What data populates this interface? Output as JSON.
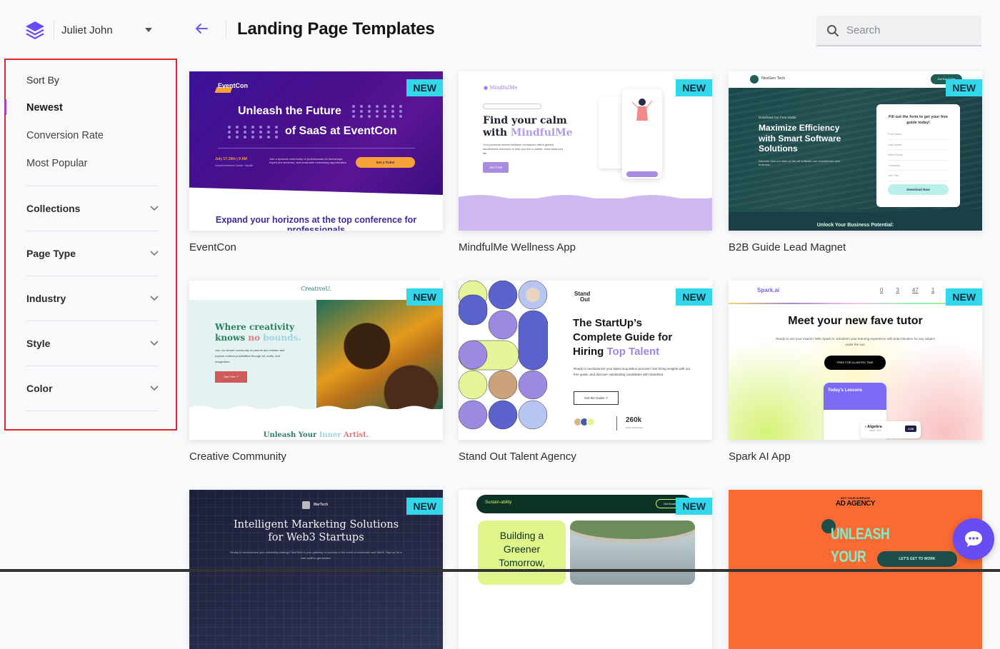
{
  "account": {
    "user_name": "Juliet John",
    "logo_icon": "layers-logo-icon",
    "dropdown_icon": "caret-down-icon"
  },
  "header": {
    "back_icon": "arrow-left-icon",
    "title": "Landing Page Templates"
  },
  "search": {
    "placeholder": "Search",
    "value": "",
    "icon": "search-icon"
  },
  "sidebar": {
    "sort_title": "Sort By",
    "sort_options": [
      {
        "label": "Newest",
        "active": true
      },
      {
        "label": "Conversion Rate",
        "active": false
      },
      {
        "label": "Most Popular",
        "active": false
      }
    ],
    "filters": [
      {
        "label": "Collections"
      },
      {
        "label": "Page Type"
      },
      {
        "label": "Industry"
      },
      {
        "label": "Style"
      },
      {
        "label": "Color"
      }
    ]
  },
  "colors": {
    "accent": "#6a4cf5",
    "badge": "#33d7ea",
    "highlight_border": "#e0242a",
    "active_indicator": "#a040c8"
  },
  "templates": [
    {
      "name": "EventCon",
      "badge": "NEW",
      "preview": {
        "brand": "EventCon",
        "headline_1": "Unleash the Future",
        "headline_2": "of SaaS at EventCon",
        "date": "July 17-19th | 9 AM",
        "location": "GrandConference Center, Cityville",
        "description": "Join a dynamic community of professionals for workshops, expert-led seminars, and invaluable networking opportunities.",
        "cta": "Get a Ticket",
        "subheading": "Expand your horizons at the top conference for professionals"
      }
    },
    {
      "name": "MindfulMe Wellness App",
      "badge": "NEW",
      "preview": {
        "brand": "MindfulMe",
        "headline_1": "Find your calm",
        "headline_2_pre": "with ",
        "headline_2_accent": "MindfulMe",
        "description": "Your personal mental wellness companion offers guided mindfulness exercises to help you live a calmer, more balanced life.",
        "cta": "Join Free"
      }
    },
    {
      "name": "B2B Guide Lead Magnet",
      "badge": "NEW",
      "preview": {
        "brand": "NexGen Tech",
        "nav_cta": "Get the Guide",
        "eyebrow": "Download Our Free Guide:",
        "headline": "Maximize Efficiency with Smart Software Solutions",
        "description": "Discover how our state-of-the-art software can revolutionize your business.",
        "form_title": "Fill out the form to get your free guide today!",
        "fields": [
          "First Name",
          "Last Name",
          "Work Email",
          "Company",
          "Job Title"
        ],
        "cta": "Download Now",
        "bottom": "Unlock Your Business Potential:"
      }
    },
    {
      "name": "Creative Community",
      "badge": "NEW",
      "preview": {
        "brand": "CreativeU.",
        "headline_1": "Where creativity",
        "headline_2_pre": "knows ",
        "headline_2_no": "no",
        "headline_2_bounds": " bounds.",
        "description": "Join our vibrant community of parents and children and explore endless possibilities through art, crafts, and imagination.",
        "cta": "Join Free ↗",
        "sub_1": "Unleash Your ",
        "sub_2": "Inner",
        "sub_3": " Artist."
      }
    },
    {
      "name": "Stand Out Talent Agency",
      "badge": "NEW",
      "preview": {
        "brand_1": "Stand",
        "brand_2": "Out",
        "headline_1": "The StartUp’s",
        "headline_2": "Complete Guide for",
        "headline_3_pre": "Hiring ",
        "headline_3_accent": "Top Talent",
        "description": "Ready to revolutionize your talent acquisition process? Get hiring insights with our free guide, and discover outstanding candidates with StandOut.",
        "cta": "Get the Guide ↗",
        "stat_value": "260k",
        "stat_label": "Active Businesses"
      }
    },
    {
      "name": "Spark AI App",
      "badge": "NEW",
      "preview": {
        "brand": "Spark.ai",
        "stats": [
          "0",
          "3",
          "47",
          "1"
        ],
        "headline": "Meet your new fave tutor",
        "description": "Ready to ace your exams? With Spark.AI, transform your learning experience with brain benders for any subject under the sun.",
        "cta": "FREE FOR A LIMITED TIME",
        "phone_title": "Today's Lessons",
        "chip_title": "Algebra",
        "chip_sub": "Mock Test",
        "chip_timer": "1:28"
      }
    },
    {
      "name": "",
      "badge": "NEW",
      "preview": {
        "brand": "MarTech",
        "headline": "Intelligent Marketing Solutions for Web3 Startups",
        "description": "Ready to revolutionize your marketing strategy? MarTech is your gateway to success in the world of blockchain and Web3. Sign up for a free audit to get started."
      }
    },
    {
      "name": "",
      "badge": "NEW",
      "preview": {
        "brand": "Sustain-ability",
        "nav_cta": "Get Growing",
        "headline": "Building a Greener Tomorrow,"
      }
    },
    {
      "name": "",
      "badge": "",
      "preview": {
        "eyebrow": "NOT YOUR AVERAGE",
        "brand": "AD AGENCY",
        "headline_1": "UNLEASH",
        "headline_2": "YOUR",
        "cta": "LET'S GET TO WORK"
      }
    }
  ],
  "chat": {
    "icon": "chat-bubble-icon"
  }
}
